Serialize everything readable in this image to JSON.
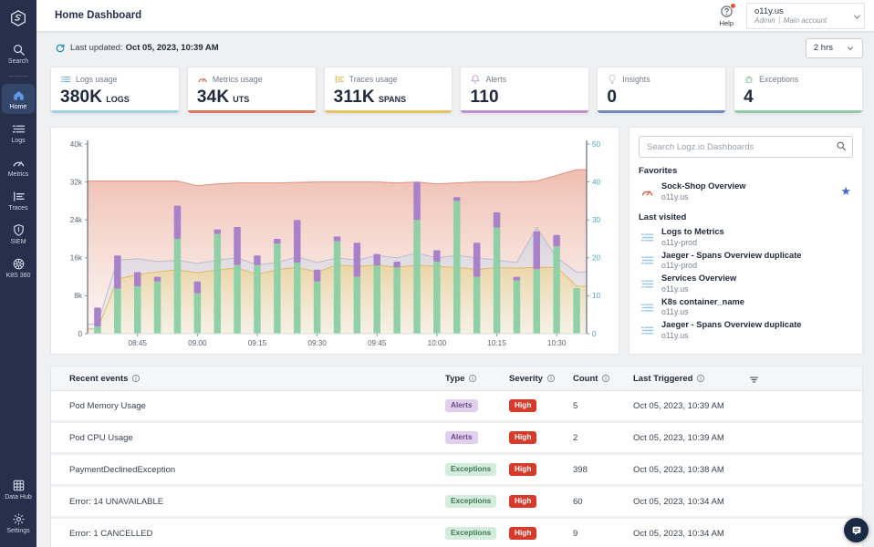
{
  "header": {
    "title": "Home Dashboard",
    "help_label": "Help",
    "account": {
      "name": "o11y.us",
      "role": "Admin",
      "type": "Main account"
    }
  },
  "toolbar": {
    "last_updated_label": "Last updated:",
    "last_updated_value": "Oct 05, 2023, 10:39 AM",
    "time_range": "2 hrs"
  },
  "sidebar": {
    "items": [
      {
        "label": "Search",
        "icon": "search-icon",
        "active": false
      },
      {
        "label": "Home",
        "icon": "home-icon",
        "active": true
      },
      {
        "label": "Logs",
        "icon": "logs-icon",
        "active": false
      },
      {
        "label": "Metrics",
        "icon": "metrics-icon",
        "active": false
      },
      {
        "label": "Traces",
        "icon": "traces-icon",
        "active": false
      },
      {
        "label": "SIEM",
        "icon": "siem-icon",
        "active": false
      },
      {
        "label": "K8S 360",
        "icon": "k8s-icon",
        "active": false
      }
    ],
    "bottom_items": [
      {
        "label": "Data Hub",
        "icon": "data-hub-icon",
        "active": false
      },
      {
        "label": "Settings",
        "icon": "settings-icon",
        "active": false
      }
    ]
  },
  "stat_cards": [
    {
      "label": "Logs usage",
      "value": "380K",
      "unit": "LOGS",
      "accent": "#9fd2e2",
      "icon": "logs-icon",
      "icon_color": "#6aaecf"
    },
    {
      "label": "Metrics usage",
      "value": "34K",
      "unit": "UTS",
      "accent": "#d97862",
      "icon": "metrics-icon",
      "icon_color": "#d9604a"
    },
    {
      "label": "Traces usage",
      "value": "311K",
      "unit": "SPANS",
      "accent": "#e5c365",
      "icon": "traces-icon",
      "icon_color": "#e0b040"
    },
    {
      "label": "Alerts",
      "value": "110",
      "unit": "",
      "accent": "#bd8fcc",
      "icon": "bell-icon",
      "icon_color": "#b98fd0"
    },
    {
      "label": "Insights",
      "value": "0",
      "unit": "",
      "accent": "#7088bb",
      "icon": "bulb-icon",
      "icon_color": "#c3c8d0"
    },
    {
      "label": "Exceptions",
      "value": "4",
      "unit": "",
      "accent": "#8fc9a8",
      "icon": "exceptions-icon",
      "icon_color": "#8fc9a8"
    }
  ],
  "chart_data": {
    "type": "bar",
    "x": [
      "08:35",
      "08:40",
      "08:45",
      "08:50",
      "08:55",
      "09:00",
      "09:05",
      "09:10",
      "09:15",
      "09:20",
      "09:25",
      "09:30",
      "09:35",
      "09:40",
      "09:45",
      "09:50",
      "09:55",
      "10:00",
      "10:05",
      "10:10",
      "10:15",
      "10:20",
      "10:25",
      "10:30",
      "10:35"
    ],
    "x_tick_indices": [
      2,
      5,
      8,
      11,
      14,
      17,
      20,
      23
    ],
    "left_axis": {
      "max": 40,
      "tick_values": [
        0,
        8,
        16,
        24,
        32,
        40
      ],
      "tick_labels": [
        "0",
        "8k",
        "16k",
        "24k",
        "32k",
        "40k"
      ],
      "color": "#5a6470"
    },
    "right_axis": {
      "max": 50,
      "tick_values": [
        0,
        10,
        20,
        30,
        40,
        50
      ],
      "tick_labels": [
        "0",
        "10",
        "20",
        "30",
        "40",
        "50"
      ],
      "color": "#4aa5bd"
    },
    "series": [
      {
        "name": "red-area",
        "type": "area",
        "line_color": "#df8f7b",
        "fill_from": "#edb3a3",
        "fill_to": "#f9ece7",
        "values": [
          32.2,
          32.2,
          32.2,
          32.2,
          32.2,
          31.2,
          31.6,
          31.8,
          31.8,
          31.8,
          31.9,
          32,
          32,
          32,
          32,
          31.8,
          32,
          31.6,
          31.8,
          32,
          32,
          32,
          32.2,
          33.4,
          34.6
        ]
      },
      {
        "name": "gray-area",
        "type": "area",
        "line_color": "#bcbccd",
        "fill_from": "#d2d2df",
        "fill_to": "#efeff3",
        "values": [
          2,
          15.5,
          15.8,
          15.2,
          15.5,
          14.8,
          15.5,
          16,
          14.5,
          15,
          16.2,
          15,
          16,
          15.5,
          16.5,
          16,
          17,
          16,
          16.5,
          16,
          15.5,
          15,
          22.4,
          16,
          13
        ]
      },
      {
        "name": "yellow-area",
        "type": "area",
        "line_color": "#dfba67",
        "fill_from": "#ecd49b",
        "fill_to": "#f8efdc",
        "values": [
          1,
          11.5,
          12.5,
          13,
          13.5,
          12.8,
          13.5,
          13.8,
          12.5,
          13.5,
          14,
          13,
          14.5,
          14.2,
          14.5,
          14,
          14.5,
          14.2,
          14,
          13.5,
          14,
          13.8,
          14,
          14,
          10
        ]
      },
      {
        "name": "logs-bars-green",
        "type": "bar",
        "color": "#8fd0a7",
        "values": [
          1.5,
          9.5,
          10,
          11,
          20,
          8.5,
          21,
          14.5,
          14.5,
          19,
          15,
          11,
          19.5,
          12,
          14.4,
          14,
          24,
          15.2,
          28,
          12,
          22.4,
          11.2,
          13.6,
          18.4,
          9.6
        ]
      },
      {
        "name": "spans-bars-purple",
        "type": "bar",
        "color": "#a981c9",
        "stacked_on": "logs-bars-green",
        "values": [
          4,
          7,
          3,
          1,
          7,
          2.5,
          1,
          8,
          2,
          1,
          9,
          2.5,
          1,
          7.2,
          2.4,
          1.2,
          8,
          2.4,
          0.8,
          7.2,
          3.2,
          0.8,
          8,
          2.4,
          0
        ]
      }
    ],
    "title": "",
    "xlabel": "",
    "ylabel": "",
    "legend": "none",
    "grid": false
  },
  "dashboards_panel": {
    "search_placeholder": "Search Logz.io Dashboards",
    "favorites_label": "Favorites",
    "favorites": [
      {
        "title": "Sock-Shop Overview",
        "account": "o11y.us",
        "icon": "gauge-icon",
        "starred": true,
        "star_glyph": "★"
      }
    ],
    "last_visited_label": "Last visited",
    "last_visited": [
      {
        "title": "Logs to Metrics",
        "account": "o11y-prod",
        "icon": "dashboard-logs-icon"
      },
      {
        "title": "Jaeger - Spans Overview duplicate",
        "account": "o11y-prod",
        "icon": "dashboard-logs-icon"
      },
      {
        "title": "Services Overview",
        "account": "o11y.us",
        "icon": "dashboard-logs-icon"
      },
      {
        "title": "K8s container_name",
        "account": "o11y.us",
        "icon": "dashboard-logs-icon"
      },
      {
        "title": "Jaeger - Spans Overview duplicate",
        "account": "o11y.us",
        "icon": "dashboard-logs-icon"
      }
    ]
  },
  "events_table": {
    "columns": [
      {
        "label": "Recent events",
        "info": true
      },
      {
        "label": "Type",
        "info": true
      },
      {
        "label": "Severity",
        "info": true
      },
      {
        "label": "Count",
        "info": true
      },
      {
        "label": "Last Triggered",
        "info": true
      }
    ],
    "rows": [
      {
        "name": "Pod Memory Usage",
        "type": "Alerts",
        "severity": "High",
        "count": "5",
        "last_triggered": "Oct 05, 2023, 10:39 AM"
      },
      {
        "name": "Pod CPU Usage",
        "type": "Alerts",
        "severity": "High",
        "count": "2",
        "last_triggered": "Oct 05, 2023, 10:39 AM"
      },
      {
        "name": "PaymentDeclinedException",
        "type": "Exceptions",
        "severity": "High",
        "count": "398",
        "last_triggered": "Oct 05, 2023, 10:38 AM"
      },
      {
        "name": "Error: 14 UNAVAILABLE",
        "type": "Exceptions",
        "severity": "High",
        "count": "60",
        "last_triggered": "Oct 05, 2023, 10:34 AM"
      },
      {
        "name": "Error: 1 CANCELLED",
        "type": "Exceptions",
        "severity": "High",
        "count": "9",
        "last_triggered": "Oct 05, 2023, 10:34 AM"
      }
    ]
  },
  "colors": {
    "sidebar_bg": "#26304a",
    "sidebar_active_bg": "#35466b",
    "accent_teal": "#0b8aa2",
    "badge_high": "#d63b2a",
    "star_blue": "#4668c8"
  }
}
